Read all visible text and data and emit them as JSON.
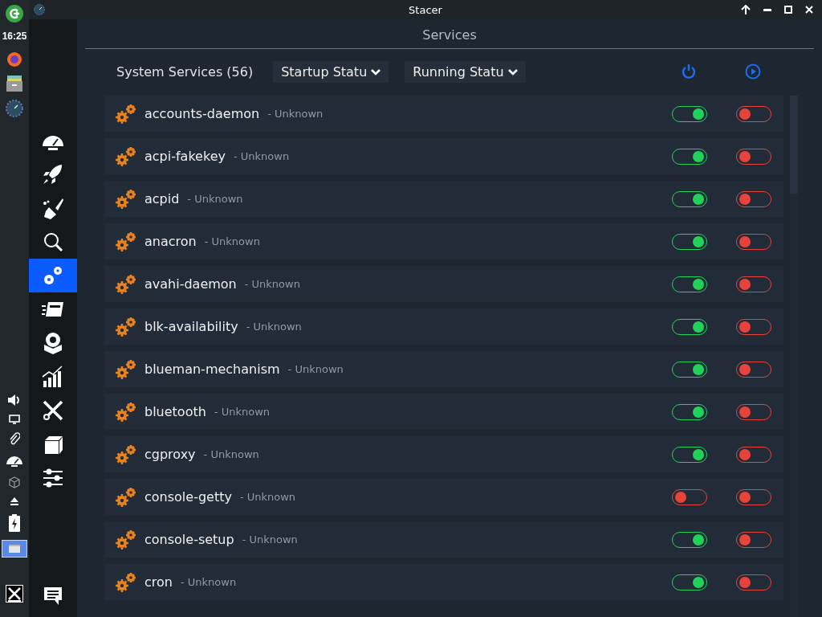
{
  "window": {
    "title": "Stacer"
  },
  "taskbar": {
    "clock": "16:25"
  },
  "sidebar": {
    "items": [
      {
        "selected": false
      },
      {
        "selected": false
      },
      {
        "selected": false
      },
      {
        "selected": false
      },
      {
        "selected": true
      },
      {
        "selected": false
      },
      {
        "selected": false
      },
      {
        "selected": false
      },
      {
        "selected": false
      },
      {
        "selected": false
      },
      {
        "selected": false
      }
    ]
  },
  "page": {
    "title": "Services"
  },
  "toolbar": {
    "label": "System Services (56)",
    "startup_filter": "Startup Statu",
    "running_filter": "Running Statu"
  },
  "services": [
    {
      "name": "accounts-daemon",
      "status": "- Unknown",
      "startup": true,
      "running": false
    },
    {
      "name": "acpi-fakekey",
      "status": "- Unknown",
      "startup": true,
      "running": false
    },
    {
      "name": "acpid",
      "status": "- Unknown",
      "startup": true,
      "running": false
    },
    {
      "name": "anacron",
      "status": "- Unknown",
      "startup": true,
      "running": false
    },
    {
      "name": "avahi-daemon",
      "status": "- Unknown",
      "startup": true,
      "running": false
    },
    {
      "name": "blk-availability",
      "status": "- Unknown",
      "startup": true,
      "running": false
    },
    {
      "name": "blueman-mechanism",
      "status": "- Unknown",
      "startup": true,
      "running": false
    },
    {
      "name": "bluetooth",
      "status": "- Unknown",
      "startup": true,
      "running": false
    },
    {
      "name": "cgproxy",
      "status": "- Unknown",
      "startup": true,
      "running": false
    },
    {
      "name": "console-getty",
      "status": "- Unknown",
      "startup": false,
      "running": false
    },
    {
      "name": "console-setup",
      "status": "- Unknown",
      "startup": true,
      "running": false
    },
    {
      "name": "cron",
      "status": "- Unknown",
      "startup": true,
      "running": false
    }
  ]
}
